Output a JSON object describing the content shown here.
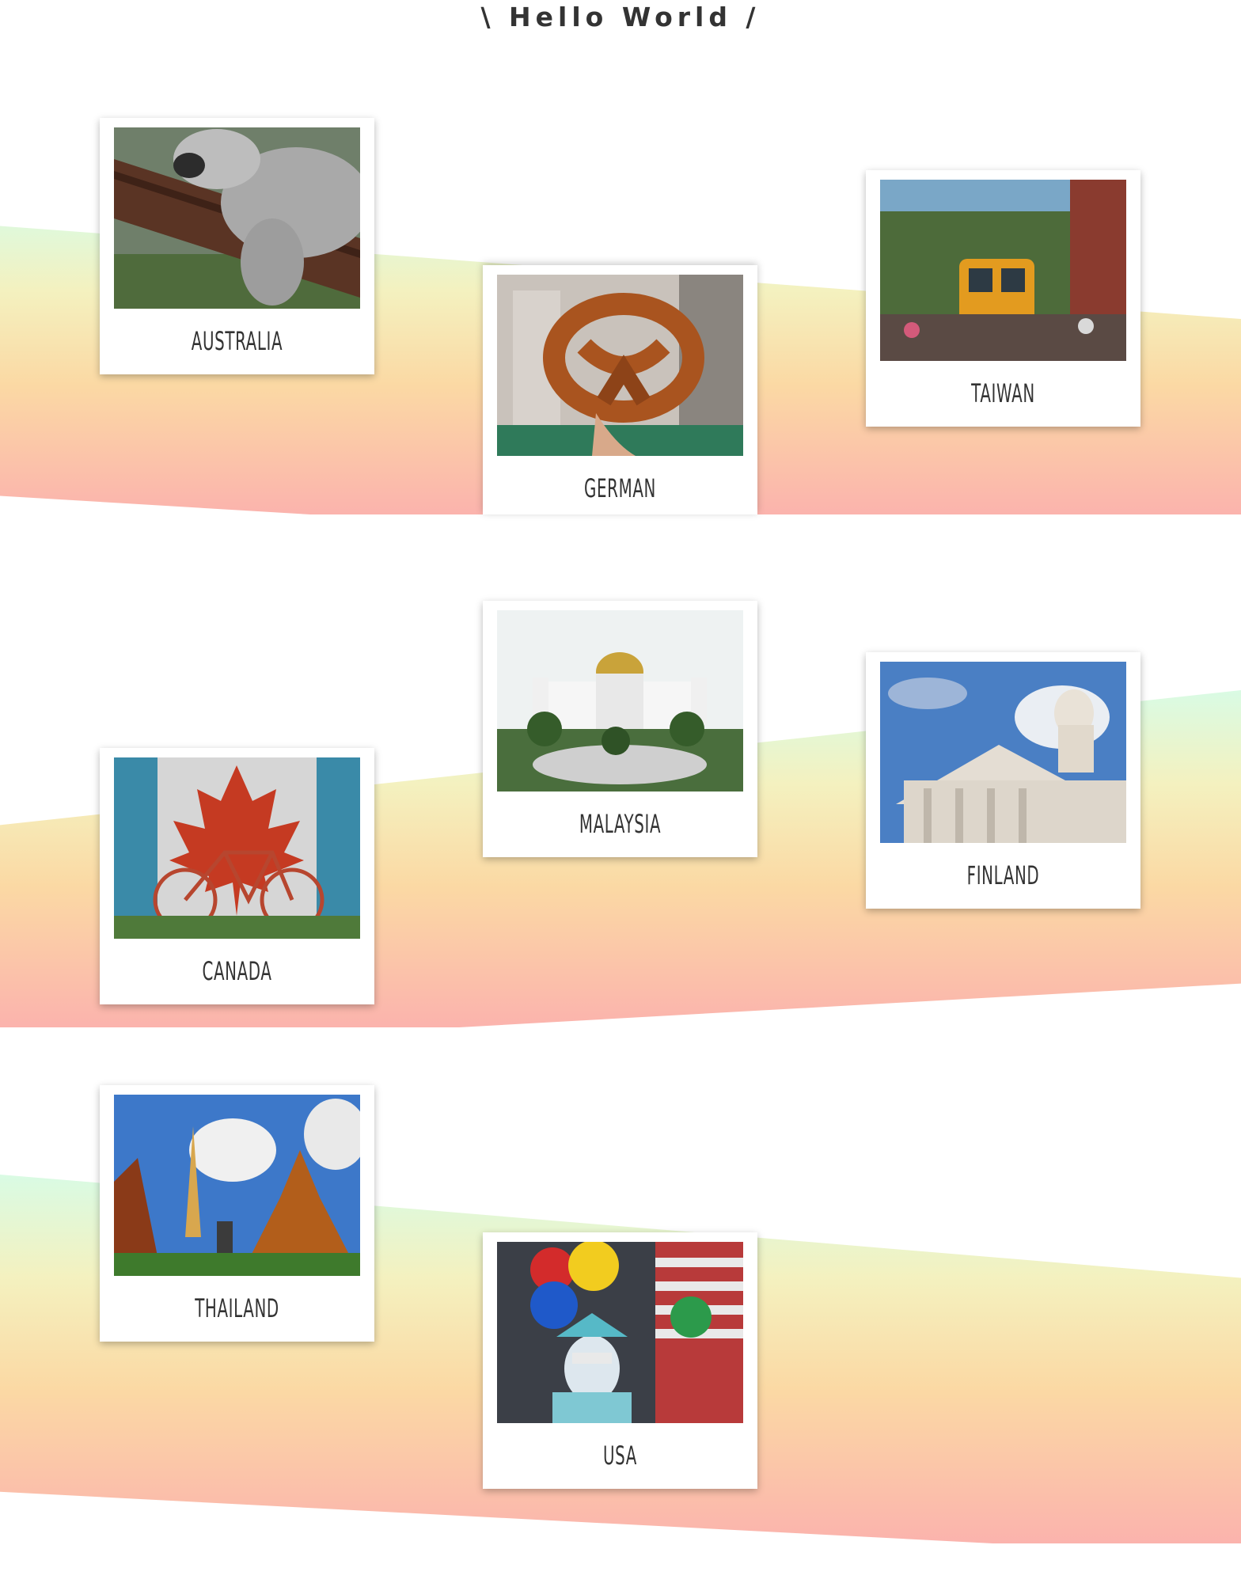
{
  "page": {
    "title": "\\ Hello World /"
  },
  "cards": [
    {
      "id": "australia",
      "label": "AUSTRALIA",
      "photo_icon": "koala-photo"
    },
    {
      "id": "german",
      "label": "GERMAN",
      "photo_icon": "pretzel-photo"
    },
    {
      "id": "taiwan",
      "label": "TAIWAN",
      "photo_icon": "train-photo"
    },
    {
      "id": "malaysia",
      "label": "MALAYSIA",
      "photo_icon": "mosque-photo"
    },
    {
      "id": "canada",
      "label": "CANADA",
      "photo_icon": "maple-leaf-bicycle-photo"
    },
    {
      "id": "finland",
      "label": "FINLAND",
      "photo_icon": "cathedral-photo"
    },
    {
      "id": "thailand",
      "label": "THAILAND",
      "photo_icon": "temple-photo"
    },
    {
      "id": "usa",
      "label": "USA",
      "photo_icon": "statue-of-liberty-costume-photo"
    }
  ],
  "colors": {
    "band_top": "#d9fbe4",
    "band_mid": "#fbd9a4",
    "band_bottom": "#fbb3ad",
    "text": "#333333"
  }
}
